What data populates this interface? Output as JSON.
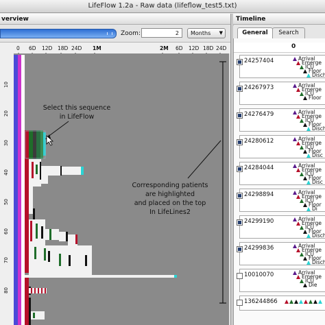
{
  "window": {
    "title": "LifeFlow 1.2a - Raw data (lifeflow_test5.txt)"
  },
  "overview_panel": {
    "title": "verview",
    "zoom_label": "Zoom:",
    "zoom_value": "2",
    "unit_selected": "Months"
  },
  "lifeflow": {
    "x_ticks": [
      "0",
      "6D",
      "12D",
      "18D",
      "24D",
      "1M",
      "2M",
      "6D",
      "12D",
      "18D",
      "24D"
    ],
    "y_ticks": [
      "10",
      "20",
      "30",
      "40",
      "50",
      "60",
      "70",
      "80"
    ],
    "annotations": {
      "select_line1": "Select this sequence",
      "select_line2": "in LifeFlow",
      "corr_line1": "Corresponding patients",
      "corr_line2": "are highlighted",
      "corr_line3": "and placed on the top",
      "corr_line4": "In LifeLines2"
    },
    "colors": {
      "arrival": "#5a1a8c",
      "emergency": "#b5102a",
      "icu": "#1f6d2a",
      "floor": "#111111",
      "discharge": "#2ad4d4",
      "background": "#8a8a8a"
    }
  },
  "timeline_panel": {
    "title": "Timeline",
    "tabs": [
      "General",
      "Search"
    ],
    "axis_zero": "0",
    "rows": [
      {
        "id": "24257404",
        "checked": true,
        "events": [
          "Arrival",
          "Emerge",
          "ICU",
          "Floor",
          "Disch"
        ]
      },
      {
        "id": "24267973",
        "checked": true,
        "events": [
          "Arrival",
          "Emerge",
          "ICU",
          "Floor"
        ]
      },
      {
        "id": "24276479",
        "checked": true,
        "events": [
          "Arrival",
          "Emerge",
          "ICU",
          "Floor",
          "Disch"
        ]
      },
      {
        "id": "24280612",
        "checked": true,
        "events": [
          "Arrival",
          "Emerge",
          "ICU",
          "Floor",
          "Disc"
        ]
      },
      {
        "id": "24284044",
        "checked": true,
        "events": [
          "Arrival",
          "Emerge",
          "ICU",
          "Floor",
          "Disc"
        ]
      },
      {
        "id": "24298894",
        "checked": true,
        "events": [
          "Arrival",
          "Emerge",
          "ICU",
          "Floor",
          "Di"
        ]
      },
      {
        "id": "24299190",
        "checked": true,
        "events": [
          "Arrival",
          "Emerge",
          "ICU",
          "Floor",
          "Disch"
        ]
      },
      {
        "id": "24299836",
        "checked": true,
        "events": [
          "Arrival",
          "Emerge",
          "ICU",
          "Floor",
          "Disch"
        ]
      },
      {
        "id": "10010070",
        "checked": false,
        "events": [
          "Arrival",
          "Emerge",
          "ICU",
          "Die"
        ]
      },
      {
        "id": "136244866",
        "checked": false,
        "events": []
      }
    ]
  }
}
